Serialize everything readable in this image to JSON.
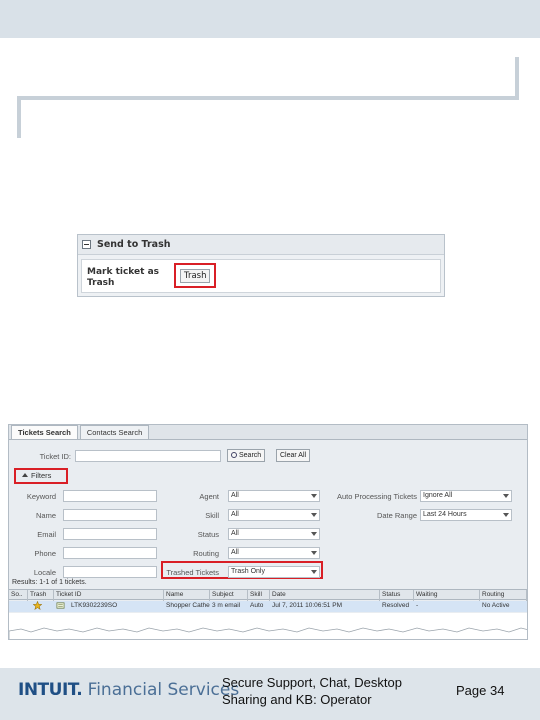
{
  "trash_panel": {
    "title": "Send to Trash",
    "label": "Mark ticket as Trash",
    "button": "Trash"
  },
  "search_panel": {
    "tabs": [
      "Tickets Search",
      "Contacts Search"
    ],
    "ticket_id_label": "Ticket ID:",
    "search_button": "Search",
    "clear_button": "Clear All",
    "filters_label": "Filters",
    "left_fields": [
      "Keyword",
      "Name",
      "Email",
      "Phone",
      "Locale"
    ],
    "mid_fields": [
      {
        "label": "Agent",
        "value": "All"
      },
      {
        "label": "Skill",
        "value": "All"
      },
      {
        "label": "Status",
        "value": "All"
      },
      {
        "label": "Routing",
        "value": "All"
      },
      {
        "label": "Trashed Tickets",
        "value": "Trash Only"
      }
    ],
    "right_fields": [
      {
        "label": "Auto Processing Tickets",
        "value": "Ignore All"
      },
      {
        "label": "Date Range",
        "value": "Last 24 Hours"
      }
    ],
    "results_text": "Results: 1-1 of 1 tickets.",
    "columns": [
      "So..",
      "Trash",
      "Ticket ID",
      "Name",
      "Subject",
      "Skill",
      "Date",
      "Status",
      "Waiting",
      "Routing"
    ],
    "row": [
      "",
      "",
      "LTK9302239SO",
      "Shopper Catherine",
      "3 m email",
      "Auto",
      "Jul 7, 2011 10:06:51 PM",
      "Resolved",
      "-",
      "No Active"
    ]
  },
  "footer": {
    "logo_brand": "INTUIT.",
    "logo_tagline": "Financial Services",
    "center_text": "Secure Support, Chat, Desktop Sharing and KB: Operator",
    "page_text": "Page 34"
  }
}
